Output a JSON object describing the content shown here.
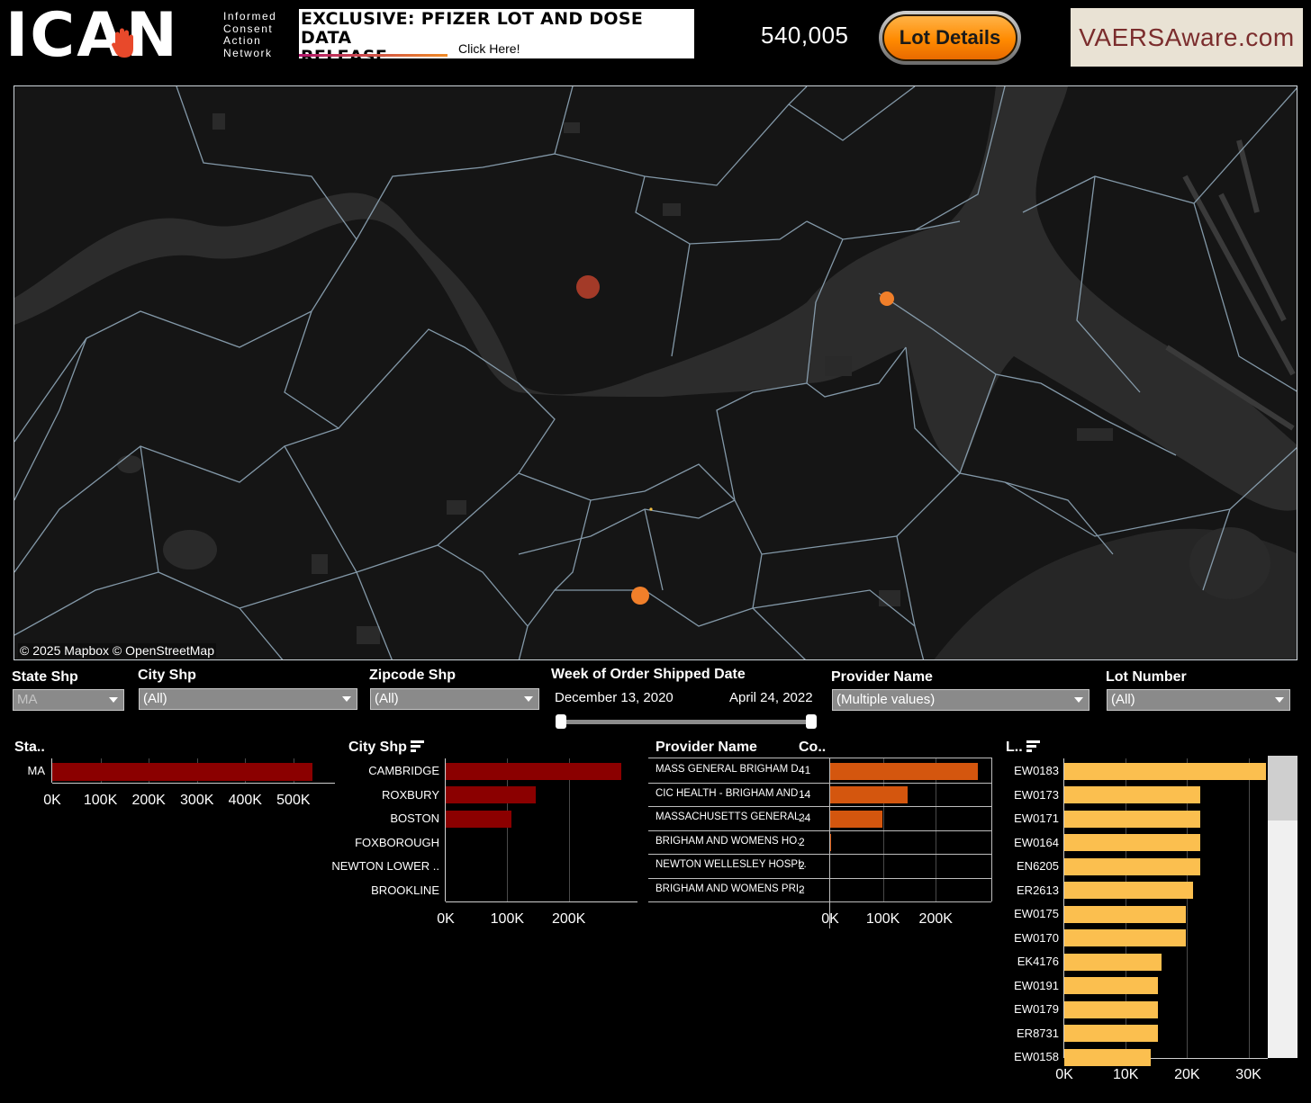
{
  "header": {
    "logo_text": "ICAN",
    "logo_tagline": [
      "Informed",
      "Consent",
      "Action",
      "Network"
    ],
    "banner_title_line1": "EXCLUSIVE: PFIZER LOT AND DOSE DATA",
    "banner_title_line2": "RELEASE",
    "banner_cta": "Click Here!",
    "total_count": "540,005",
    "lot_details_button": "Lot Details",
    "vaers_link": "VAERSAware.com"
  },
  "map": {
    "attribution": "© 2025 Mapbox © OpenStreetMap",
    "colors": {
      "large_marker": "#a33a28",
      "small_marker": "#f07f2a",
      "boundaries": "#8fa7b8"
    }
  },
  "filters": {
    "state": {
      "label": "State Shp",
      "value": "MA"
    },
    "city": {
      "label": "City Shp",
      "value": "(All)"
    },
    "zipcode": {
      "label": "Zipcode Shp",
      "value": "(All)"
    },
    "week": {
      "label": "Week of Order Shipped Date",
      "start": "December 13, 2020",
      "end": "April 24, 2022"
    },
    "provider": {
      "label": "Provider Name",
      "value": "(Multiple values)"
    },
    "lot": {
      "label": "Lot Number",
      "value": "(All)"
    }
  },
  "chart_data": [
    {
      "type": "bar",
      "title": "Sta..",
      "categories": [
        "MA"
      ],
      "values": [
        540005
      ],
      "xlim": [
        0,
        560000
      ],
      "xticks": [
        "0K",
        "100K",
        "200K",
        "300K",
        "400K",
        "500K"
      ],
      "color": "#8b0000"
    },
    {
      "type": "bar",
      "title": "City Shp",
      "categories": [
        "CAMBRIDGE",
        "ROXBURY",
        "BOSTON",
        "FOXBOROUGH",
        "NEWTON LOWER ..",
        "BROOKLINE"
      ],
      "values": [
        285000,
        147000,
        107000,
        0,
        0,
        0
      ],
      "xlim": [
        0,
        300000
      ],
      "xticks": [
        "0K",
        "100K",
        "200K"
      ],
      "color": "#8b0000"
    },
    {
      "type": "bar",
      "title": "Provider Name",
      "count_header": "Co..",
      "categories": [
        "MASS GENERAL BRIGHAM D..",
        "CIC HEALTH - BRIGHAM AND ..",
        "MASSACHUSETTS GENERAL ..",
        "BRIGHAM AND WOMENS HO..",
        "NEWTON WELLESLEY HOSPI..",
        "BRIGHAM AND WOMENS PRI.."
      ],
      "counts": [
        "41",
        "14",
        "24",
        "2",
        "2",
        "2"
      ],
      "values": [
        280000,
        147000,
        99000,
        1500,
        0,
        0
      ],
      "xlim": [
        0,
        290000
      ],
      "xticks": [
        "0K",
        "100K",
        "200K"
      ],
      "color": "#d4560e"
    },
    {
      "type": "bar",
      "title": "L..",
      "categories": [
        "EW0183",
        "EW0173",
        "EW0171",
        "EW0164",
        "EN6205",
        "ER2613",
        "EW0175",
        "EW0170",
        "EK4176",
        "EW0191",
        "EW0179",
        "ER8731",
        "EW0158"
      ],
      "values": [
        32800,
        22100,
        22100,
        22100,
        22100,
        20900,
        19800,
        19800,
        15800,
        15300,
        15300,
        15300,
        14100
      ],
      "xlim": [
        0,
        33000
      ],
      "xticks": [
        "0K",
        "10K",
        "20K",
        "30K"
      ],
      "color": "#fbbf4f"
    }
  ]
}
